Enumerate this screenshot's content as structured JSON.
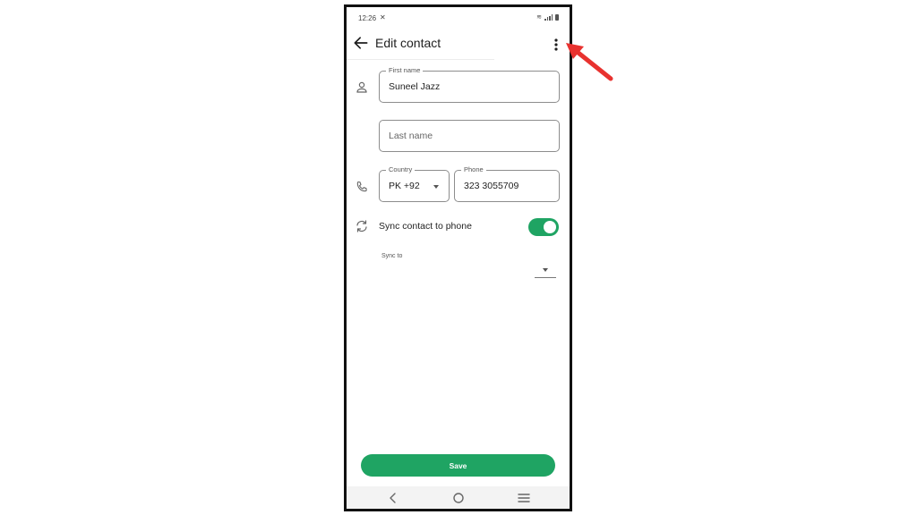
{
  "status_bar": {
    "time": "12:26"
  },
  "app_bar": {
    "title": "Edit contact"
  },
  "form": {
    "first_name": {
      "label": "First name",
      "value": "Suneel Jazz"
    },
    "last_name": {
      "placeholder": "Last name",
      "value": ""
    },
    "country": {
      "label": "Country",
      "value": "PK +92"
    },
    "phone": {
      "label": "Phone",
      "value": "323 3055709"
    },
    "sync": {
      "label": "Sync contact to phone",
      "enabled": true
    },
    "sync_to": {
      "label": "Sync to",
      "value": ""
    }
  },
  "actions": {
    "save_label": "Save"
  },
  "colors": {
    "accent": "#1fa463",
    "annotation_arrow": "#e8322f"
  },
  "icons": [
    "back-arrow-icon",
    "more-vert-icon",
    "person-icon",
    "phone-icon",
    "sync-icon",
    "nav-back-icon",
    "nav-home-icon",
    "nav-recents-icon"
  ]
}
